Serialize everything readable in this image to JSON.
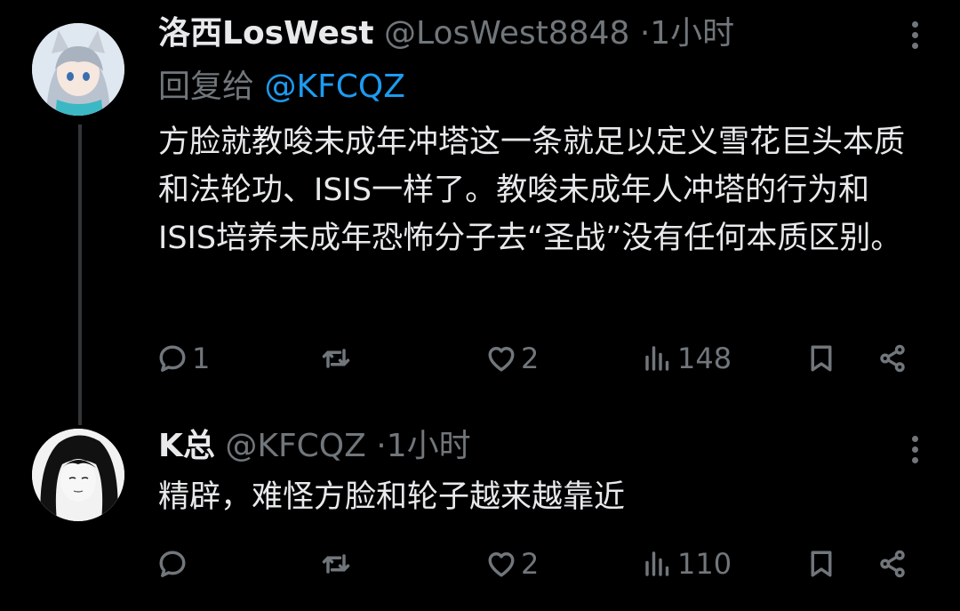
{
  "tweets": [
    {
      "display_name": "洛西LosWest",
      "handle": "@LosWest8848",
      "dot": "·",
      "time": "1小时",
      "reply_prefix": "回复给",
      "reply_mention": "@KFCQZ",
      "text": "方脸就教唆未成年冲塔这一条就足以定义雪花巨头本质和法轮功、ISIS一样了。教唆未成年人冲塔的行为和ISIS培养未成年恐怖分子去“圣战”没有任何本质区别。",
      "replies": "1",
      "retweets": "",
      "likes": "2",
      "views": "148"
    },
    {
      "display_name": "K总",
      "handle": "@KFCQZ",
      "dot": "·",
      "time": "1小时",
      "text": "精辟，难怪方脸和轮子越来越靠近",
      "replies": "",
      "retweets": "",
      "likes": "2",
      "views": "110"
    }
  ],
  "colors": {
    "background": "#000000",
    "text": "#e7e9ea",
    "secondary": "#71767b",
    "link": "#1d9bf0"
  },
  "icons": [
    "reply-icon",
    "retweet-icon",
    "like-icon",
    "views-icon",
    "bookmark-icon",
    "share-icon",
    "more-icon"
  ]
}
